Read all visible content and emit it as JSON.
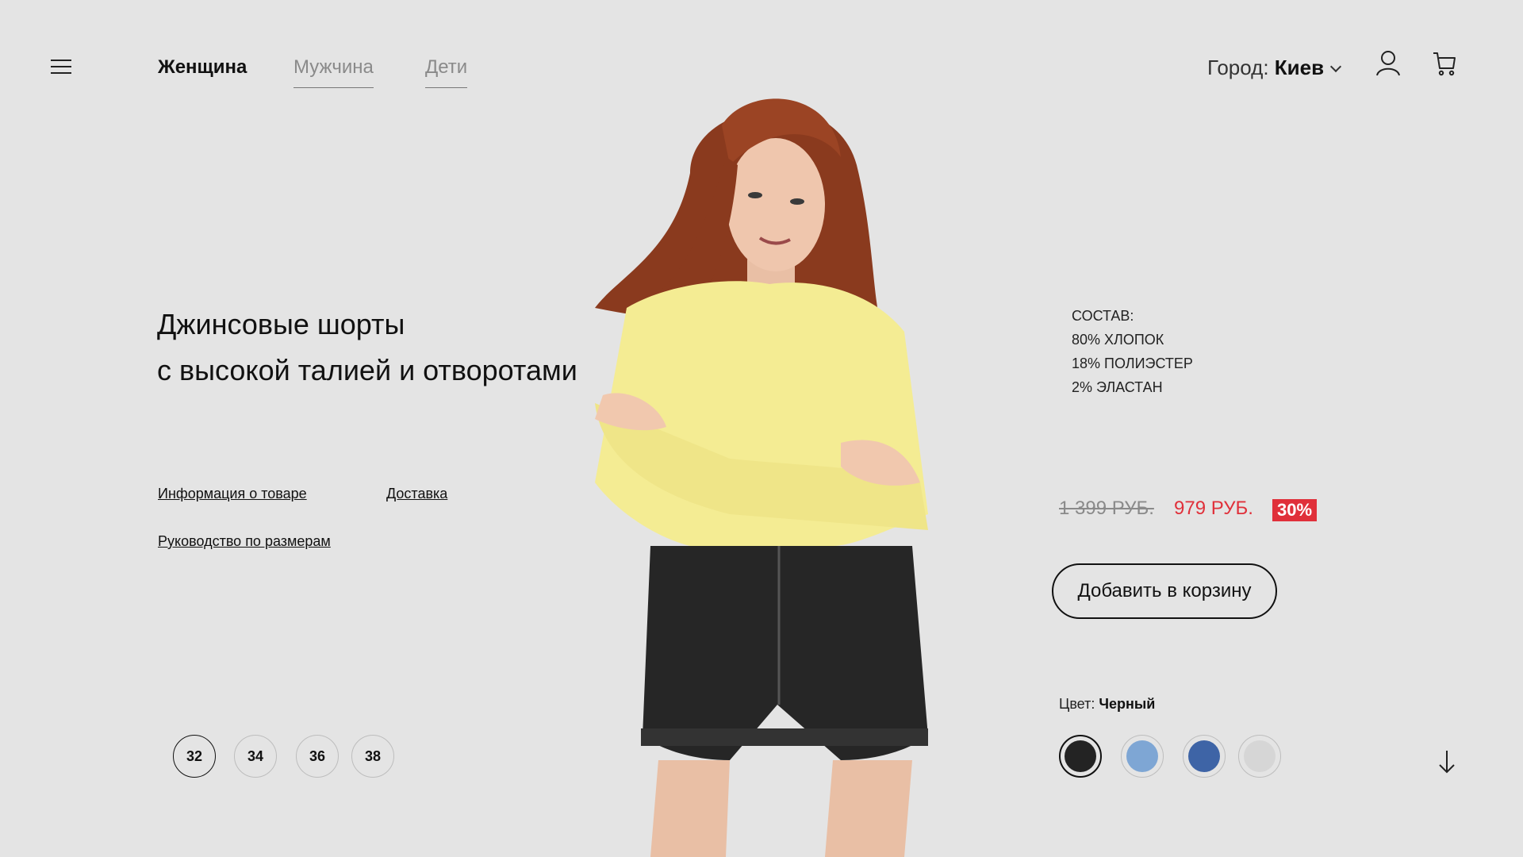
{
  "header": {
    "nav": [
      {
        "label": "Женщина",
        "active": true
      },
      {
        "label": "Мужчина",
        "active": false
      },
      {
        "label": "Дети",
        "active": false
      }
    ],
    "city_label": "Город:",
    "city_value": "Киев",
    "icons": [
      "menu-icon",
      "user-icon",
      "cart-icon"
    ]
  },
  "product": {
    "title_line1": "Джинсовые шорты",
    "title_line2": "с высокой талией и отворотами",
    "links": {
      "info": "Информация о товаре",
      "delivery": "Доставка",
      "size_guide": "Руководство по размерам"
    },
    "composition": {
      "heading": "СОСТАВ:",
      "items": [
        "80% ХЛОПОК",
        "18% ПОЛИЭСТЕР",
        "2% ЭЛАСТАН"
      ]
    },
    "old_price": "1 399 РУБ.",
    "new_price": "979 РУБ.",
    "discount": "30%",
    "add_to_cart": "Добавить в корзину",
    "color_label": "Цвет:",
    "color_value": "Черный",
    "colors": [
      "#232323",
      "#7ea6d4",
      "#3e64a6",
      "#d6d6d6"
    ],
    "selected_color_index": 0,
    "sizes": [
      "32",
      "34",
      "36",
      "38"
    ],
    "selected_size_index": 0
  },
  "theme": {
    "background": "#e4e4e4",
    "accent": "#e0303a"
  }
}
